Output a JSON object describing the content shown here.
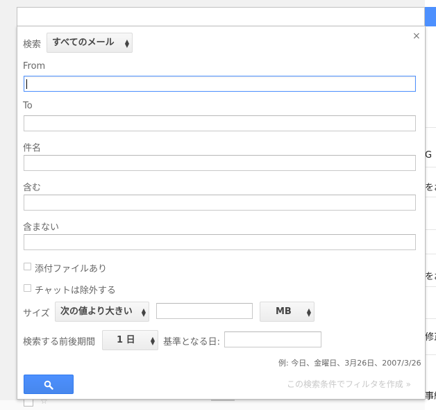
{
  "search_panel": {
    "scope_label": "検索",
    "scope_value": "すべてのメール",
    "close_glyph": "×",
    "from_label": "From",
    "from_value": "",
    "to_label": "To",
    "to_value": "",
    "subject_label": "件名",
    "subject_value": "",
    "has_words_label": "含む",
    "has_words_value": "",
    "doesnt_have_label": "含まない",
    "doesnt_have_value": "",
    "has_attachment_label": "添付ファイルあり",
    "has_attachment_checked": false,
    "exclude_chats_label": "チャットは除外する",
    "exclude_chats_checked": false,
    "size_label": "サイズ",
    "size_operator": "次の値より大きい",
    "size_value": "",
    "size_unit": "MB",
    "date_within_label": "検索する前後期間",
    "date_within_value": "1 日",
    "date_of_label": "基準となる日:",
    "date_of_value": "",
    "date_hint": "例: 今日、金曜日、3月26日、2007/3/26",
    "create_filter_link": "この検索条件でフィルタを作成 »"
  },
  "background_list": {
    "fragments": [
      "G",
      "をお",
      "をお",
      "修正",
      "事紹"
    ]
  },
  "colors": {
    "accent_blue": "#4d90fe",
    "panel_border": "#bdbdbd",
    "label_gray": "#666666"
  }
}
